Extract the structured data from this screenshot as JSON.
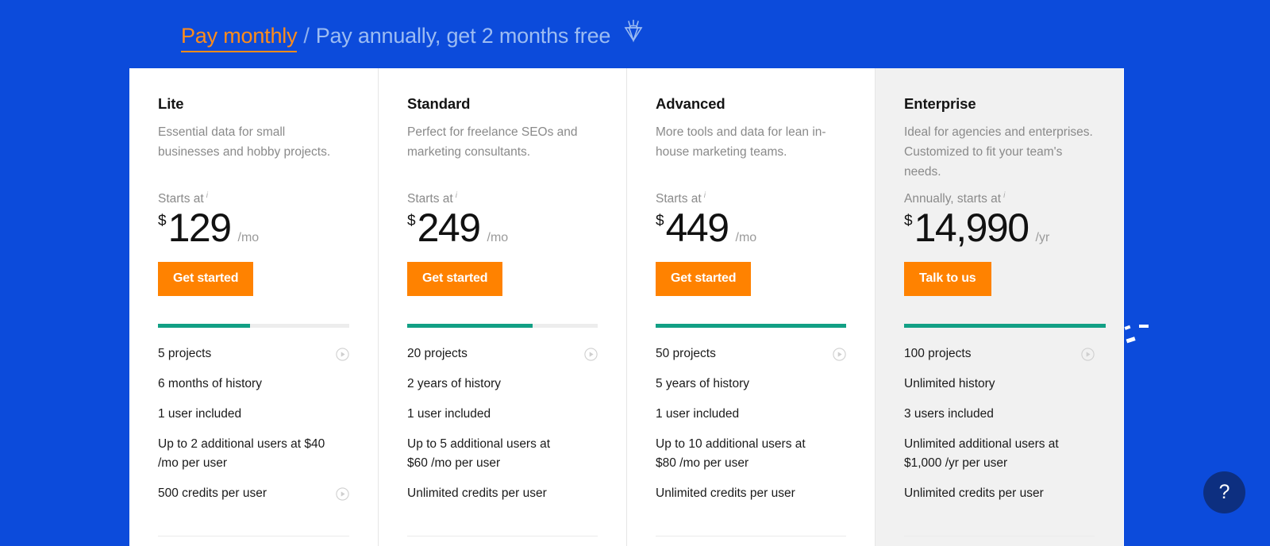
{
  "header": {
    "monthly_label": "Pay monthly",
    "separator": "/",
    "annual_label": "Pay annually, get 2 months free",
    "gem_icon": "gem-icon",
    "accent_color": "#ff8c1a",
    "background_color": "#0c4bdb"
  },
  "plans": [
    {
      "name": "Lite",
      "description": "Essential data for small businesses and hobby projects.",
      "starts_label": "Starts at",
      "info_icon": "info-icon",
      "currency": "$",
      "amount": "129",
      "period": "/mo",
      "cta_label": "Get started",
      "meter_percent": 48,
      "features": [
        {
          "text": "5 projects",
          "has_video": true
        },
        {
          "text": "6 months of history",
          "has_video": false
        },
        {
          "text": "1 user included",
          "has_video": false
        },
        {
          "text": "Up to 2 additional users at $40 /mo per user",
          "has_video": false
        },
        {
          "text": "500 credits per user",
          "has_video": true
        }
      ]
    },
    {
      "name": "Standard",
      "description": "Perfect for freelance SEOs and marketing consultants.",
      "starts_label": "Starts at",
      "info_icon": "info-icon",
      "currency": "$",
      "amount": "249",
      "period": "/mo",
      "cta_label": "Get started",
      "meter_percent": 66,
      "features": [
        {
          "text": "20 projects",
          "has_video": true
        },
        {
          "text": "2 years of history",
          "has_video": false
        },
        {
          "text": "1 user included",
          "has_video": false
        },
        {
          "text": "Up to 5 additional users at $60 /mo per user",
          "has_video": false
        },
        {
          "text": "Unlimited credits per user",
          "has_video": false
        }
      ]
    },
    {
      "name": "Advanced",
      "description": "More tools and data for lean in-house marketing teams.",
      "starts_label": "Starts at",
      "info_icon": "info-icon",
      "currency": "$",
      "amount": "449",
      "period": "/mo",
      "cta_label": "Get started",
      "meter_percent": 100,
      "features": [
        {
          "text": "50 projects",
          "has_video": true
        },
        {
          "text": "5 years of history",
          "has_video": false
        },
        {
          "text": "1 user included",
          "has_video": false
        },
        {
          "text": "Up to 10 additional users at $80 /mo per user",
          "has_video": false
        },
        {
          "text": "Unlimited credits per user",
          "has_video": false
        }
      ]
    },
    {
      "name": "Enterprise",
      "description": "Ideal for agencies and enterprises. Customized to fit your team's needs.",
      "starts_label": "Annually, starts at",
      "info_icon": "info-icon",
      "currency": "$",
      "amount": "14,990",
      "period": "/yr",
      "cta_label": "Talk to us",
      "meter_percent": 106,
      "highlight": true,
      "features": [
        {
          "text": "100 projects",
          "has_video": true
        },
        {
          "text": "Unlimited history",
          "has_video": false
        },
        {
          "text": "3 users included",
          "has_video": false
        },
        {
          "text": "Unlimited additional users at $1,000 /yr per user",
          "has_video": false
        },
        {
          "text": "Unlimited credits per user",
          "has_video": false
        }
      ]
    }
  ],
  "help": {
    "label": "?",
    "icon": "question-mark-icon",
    "background_color": "#0d2f80"
  },
  "colors": {
    "cta": "#ff8200",
    "meter_fill": "#12a085",
    "meter_track": "#ededed",
    "card_highlight_bg": "#f1f1f1"
  }
}
